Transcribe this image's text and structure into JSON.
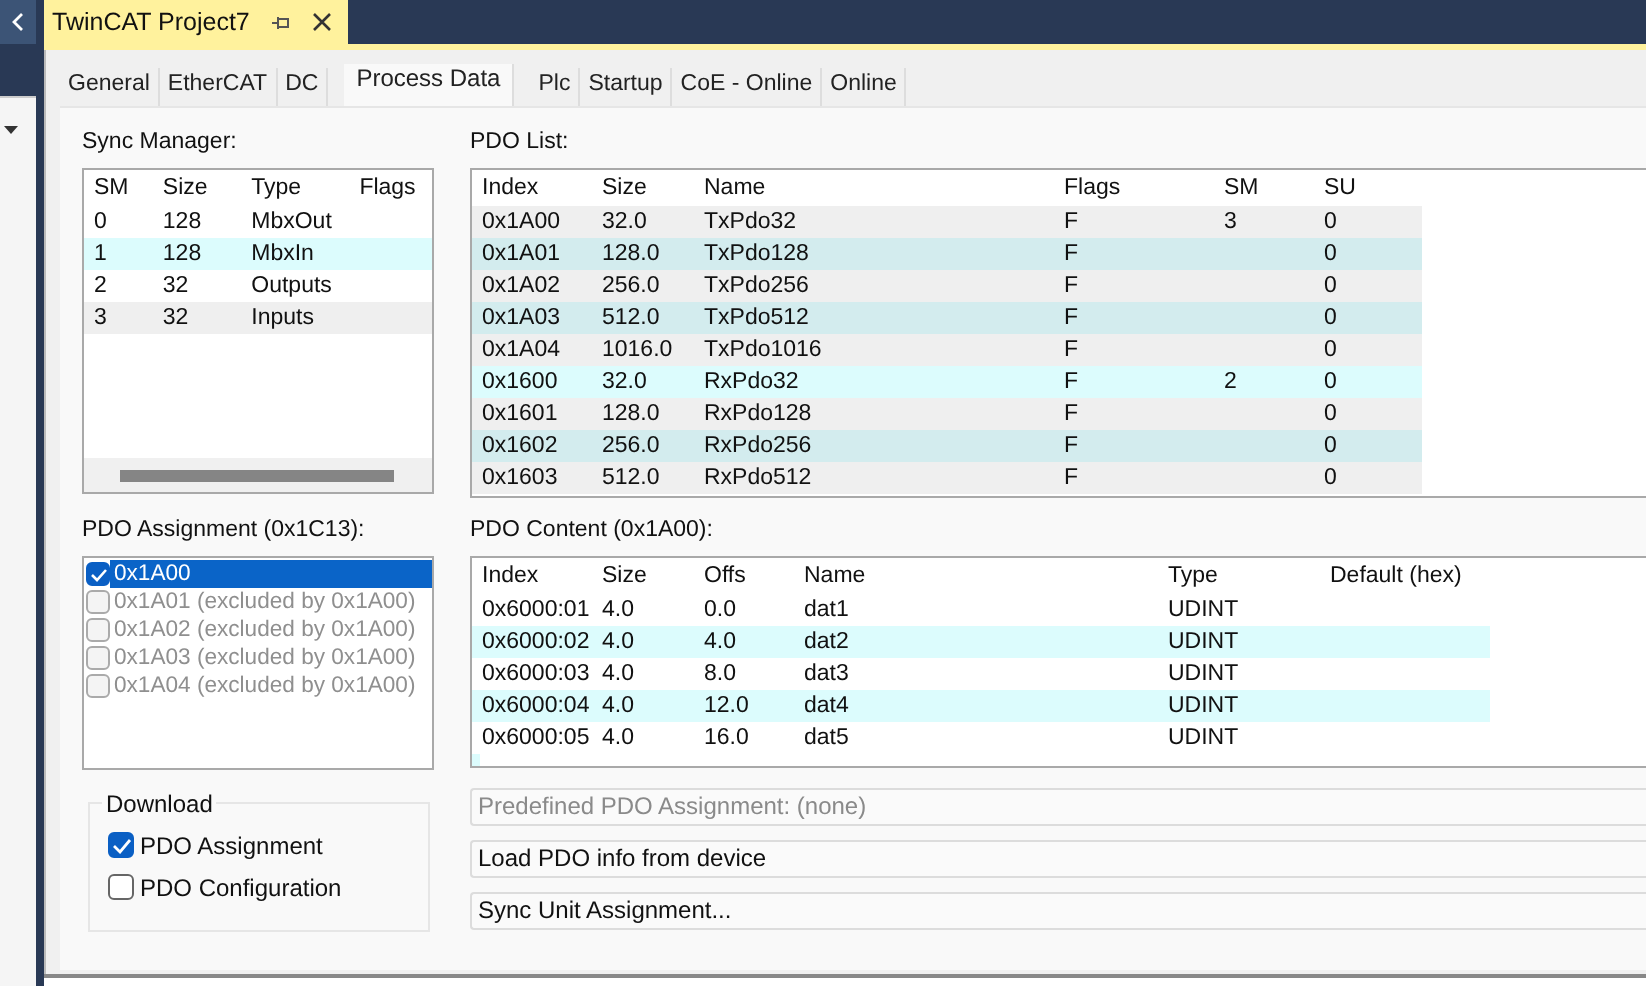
{
  "document_tab": {
    "title": "TwinCAT Project7"
  },
  "tabs": [
    {
      "label": "General",
      "selected": false
    },
    {
      "label": "EtherCAT",
      "selected": false
    },
    {
      "label": "DC",
      "selected": false
    },
    {
      "label": "Process Data",
      "selected": true
    },
    {
      "label": "Plc",
      "selected": false
    },
    {
      "label": "Startup",
      "selected": false
    },
    {
      "label": "CoE - Online",
      "selected": false
    },
    {
      "label": "Online",
      "selected": false
    }
  ],
  "sync_manager": {
    "label": "Sync Manager:",
    "columns": [
      "SM",
      "Size",
      "Type",
      "Flags"
    ],
    "rows": [
      {
        "cells": [
          "0",
          "128",
          "MbxOut",
          ""
        ],
        "selected": false
      },
      {
        "cells": [
          "1",
          "128",
          "MbxIn",
          ""
        ],
        "selected": true
      },
      {
        "cells": [
          "2",
          "32",
          "Outputs",
          ""
        ],
        "selected": false
      },
      {
        "cells": [
          "3",
          "32",
          "Inputs",
          ""
        ],
        "selected": false,
        "hover": true
      }
    ]
  },
  "pdo_list": {
    "label": "PDO List:",
    "columns": [
      "Index",
      "Size",
      "Name",
      "Flags",
      "SM",
      "SU"
    ],
    "rows": [
      {
        "cells": [
          "0x1A00",
          "32.0",
          "TxPdo32",
          "F",
          "3",
          "0"
        ],
        "selected": false
      },
      {
        "cells": [
          "0x1A01",
          "128.0",
          "TxPdo128",
          "F",
          "",
          "0"
        ],
        "selected": false
      },
      {
        "cells": [
          "0x1A02",
          "256.0",
          "TxPdo256",
          "F",
          "",
          "0"
        ],
        "selected": false
      },
      {
        "cells": [
          "0x1A03",
          "512.0",
          "TxPdo512",
          "F",
          "",
          "0"
        ],
        "selected": false
      },
      {
        "cells": [
          "0x1A04",
          "1016.0",
          "TxPdo1016",
          "F",
          "",
          "0"
        ],
        "selected": false
      },
      {
        "cells": [
          "0x1600",
          "32.0",
          "RxPdo32",
          "F",
          "2",
          "0"
        ],
        "selected": true
      },
      {
        "cells": [
          "0x1601",
          "128.0",
          "RxPdo128",
          "F",
          "",
          "0"
        ],
        "selected": false
      },
      {
        "cells": [
          "0x1602",
          "256.0",
          "RxPdo256",
          "F",
          "",
          "0"
        ],
        "selected": false
      },
      {
        "cells": [
          "0x1603",
          "512.0",
          "RxPdo512",
          "F",
          "",
          "0"
        ],
        "selected": false
      }
    ]
  },
  "pdo_assignment": {
    "label": "PDO Assignment (0x1C13):",
    "items": [
      {
        "text": "0x1A00",
        "checked": true,
        "selected": true,
        "disabled": false
      },
      {
        "text": "0x1A01 (excluded by 0x1A00)",
        "checked": false,
        "selected": false,
        "disabled": true
      },
      {
        "text": "0x1A02 (excluded by 0x1A00)",
        "checked": false,
        "selected": false,
        "disabled": true
      },
      {
        "text": "0x1A03 (excluded by 0x1A00)",
        "checked": false,
        "selected": false,
        "disabled": true
      },
      {
        "text": "0x1A04 (excluded by 0x1A00)",
        "checked": false,
        "selected": false,
        "disabled": true
      }
    ]
  },
  "pdo_content": {
    "label": "PDO Content (0x1A00):",
    "columns": [
      "Index",
      "Size",
      "Offs",
      "Name",
      "Type",
      "Default (hex)"
    ],
    "rows": [
      {
        "cells": [
          "0x6000:01",
          "4.0",
          "0.0",
          "dat1",
          "UDINT",
          ""
        ]
      },
      {
        "cells": [
          "0x6000:02",
          "4.0",
          "4.0",
          "dat2",
          "UDINT",
          ""
        ]
      },
      {
        "cells": [
          "0x6000:03",
          "4.0",
          "8.0",
          "dat3",
          "UDINT",
          ""
        ]
      },
      {
        "cells": [
          "0x6000:04",
          "4.0",
          "12.0",
          "dat4",
          "UDINT",
          ""
        ]
      },
      {
        "cells": [
          "0x6000:05",
          "4.0",
          "16.0",
          "dat5",
          "UDINT",
          ""
        ]
      }
    ]
  },
  "download": {
    "title": "Download",
    "options": [
      {
        "label": "PDO Assignment",
        "checked": true
      },
      {
        "label": "PDO Configuration",
        "checked": false
      }
    ]
  },
  "predefined": {
    "text": "Predefined PDO Assignment: (none)",
    "disabled": true
  },
  "buttons": [
    "Load PDO info from device",
    "Sync Unit Assignment..."
  ]
}
